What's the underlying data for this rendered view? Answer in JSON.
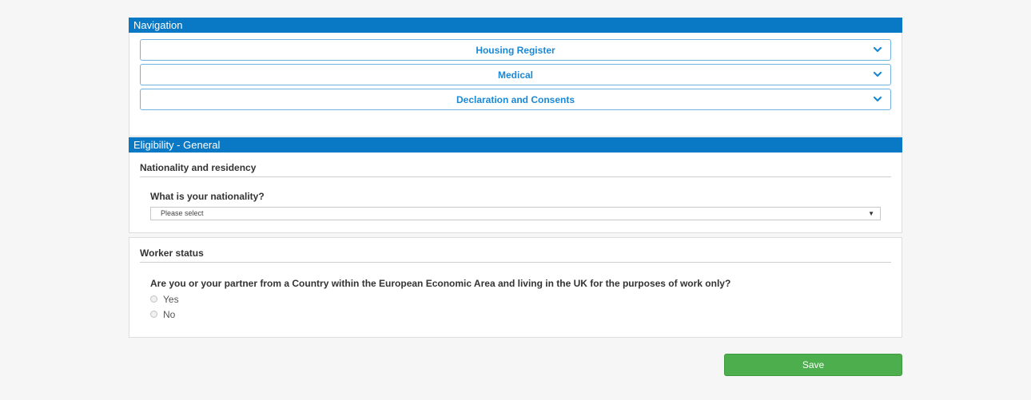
{
  "navigation": {
    "title": "Navigation",
    "items": [
      {
        "label": "Housing Register"
      },
      {
        "label": "Medical"
      },
      {
        "label": "Declaration and Consents"
      }
    ]
  },
  "eligibility": {
    "title": "Eligibility - General",
    "nationality_section": {
      "title": "Nationality and residency",
      "question": "What is your nationality?",
      "select_value": "Please select"
    },
    "worker_section": {
      "title": "Worker status",
      "question": "Are you or your partner from a Country within the European Economic Area and living in the UK for the purposes of work only?",
      "options": [
        "Yes",
        "No"
      ]
    }
  },
  "actions": {
    "save_label": "Save"
  },
  "colors": {
    "header_blue": "#0a79c5",
    "accordion_text": "#1a88d4",
    "save_green": "#4cae4c"
  }
}
